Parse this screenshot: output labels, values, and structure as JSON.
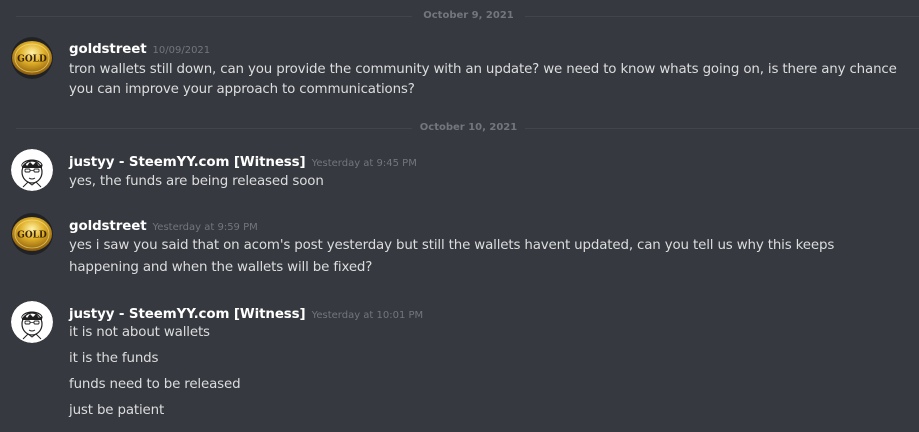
{
  "dividers": [
    {
      "date": "October 9, 2021"
    },
    {
      "date": "October 10, 2021"
    }
  ],
  "messages": [
    {
      "username": "goldstreet",
      "timestamp": "10/09/2021",
      "avatar_text": "GOLD",
      "lines": [
        "tron wallets still down, can you provide the community with an update? we need to know whats going on, is there any chance",
        "you can improve your approach to communications?"
      ]
    },
    {
      "username": "justyy - SteemYY.com [Witness]",
      "timestamp": "Yesterday at 9:45 PM",
      "lines": [
        "yes,  the funds are being released soon"
      ]
    },
    {
      "username": "goldstreet",
      "timestamp": "Yesterday at 9:59 PM",
      "avatar_text": "GOLD",
      "lines": [
        "yes i saw you said that on acom's post yesterday but still the wallets havent updated, can you tell us why this keeps",
        "happening and when the wallets will be fixed?"
      ]
    },
    {
      "username": "justyy - SteemYY.com [Witness]",
      "timestamp": "Yesterday at 10:01 PM",
      "lines": [
        "it is not about wallets",
        "it is the funds",
        "funds need to be released",
        "just be patient"
      ]
    }
  ],
  "colors": {
    "background": "#36393f",
    "username": "#ffffff",
    "message_text": "#dcddde",
    "timestamp": "#72767d",
    "gold": "#d4a017"
  }
}
